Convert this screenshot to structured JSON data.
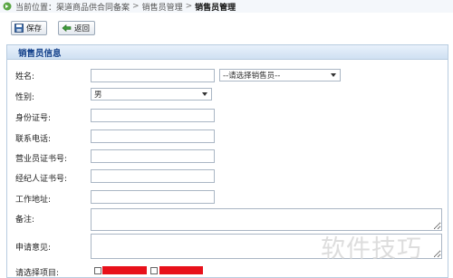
{
  "breadcrumb": {
    "prefix": "当前位置：",
    "items": [
      "渠道商品供合同备案",
      "销售员管理"
    ],
    "current": "销售员管理",
    "separator": ">"
  },
  "toolbar": {
    "save_label": "保存",
    "back_label": "返回"
  },
  "panel": {
    "title": "销售员信息"
  },
  "form": {
    "name_label": "姓名:",
    "name_value": "",
    "salesperson_select": "--请选择销售员--",
    "gender_label": "性别:",
    "gender_value": "男",
    "id_label": "身份证号:",
    "phone_label": "联系电话:",
    "license_label": "营业员证书号:",
    "agent_cert_label": "经纪人证书号:",
    "work_addr_label": "工作地址:",
    "remark_label": "备注:",
    "opinion_label": "申请意见:",
    "project_label": "请选择项目:"
  },
  "colors": {
    "header_bg": "#cfe0f2",
    "header_text": "#15428b",
    "border": "#b8cce0",
    "redact": "#e8101a"
  },
  "watermark": "软件技巧"
}
